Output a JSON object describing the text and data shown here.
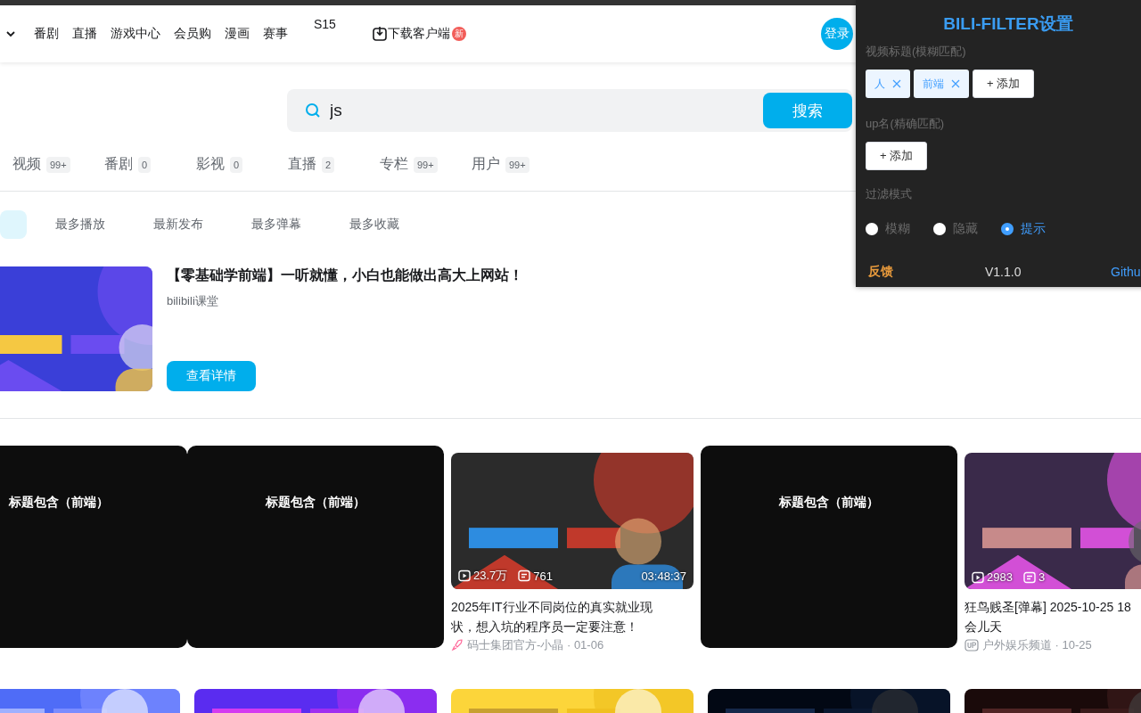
{
  "header": {
    "nav": [
      {
        "label": "番剧"
      },
      {
        "label": "直播"
      },
      {
        "label": "游戏中心"
      },
      {
        "label": "会员购"
      },
      {
        "label": "漫画"
      },
      {
        "label": "赛事"
      }
    ],
    "event": "S15",
    "download": {
      "label": "下载客户端",
      "badge": "新"
    },
    "login": "登录"
  },
  "search": {
    "value": "js",
    "button": "搜索"
  },
  "type_tabs": [
    {
      "label": "视频",
      "count": "99+"
    },
    {
      "label": "番剧",
      "count": "0"
    },
    {
      "label": "影视",
      "count": "0"
    },
    {
      "label": "直播",
      "count": "2"
    },
    {
      "label": "专栏",
      "count": "99+"
    },
    {
      "label": "用户",
      "count": "99+"
    }
  ],
  "sort_tabs": [
    {
      "selected": true
    },
    {
      "label": "最多播放",
      "selected": false
    },
    {
      "label": "最新发布",
      "selected": false
    },
    {
      "label": "最多弹幕",
      "selected": false
    },
    {
      "label": "最多收藏",
      "selected": false
    }
  ],
  "promo": {
    "title": "【零基础学前端】一听就懂，小白也能做出高大上网站！",
    "source": "bilibili课堂",
    "button": "查看详情"
  },
  "videos": [
    {
      "kind": "masked",
      "mask_label": "标题包含（前端）"
    },
    {
      "kind": "masked",
      "mask_label": "标题包含（前端）"
    },
    {
      "kind": "video",
      "views": "23.7万",
      "danmaku": "761",
      "duration": "03:48:37",
      "title_lines": [
        "2025年IT行业不同岗位的真实就业现",
        "状，想入坑的程序员一定要注意！"
      ],
      "author_icon": {
        "kind": "rocket"
      },
      "author": "码士集团官方-小晶 · 01-06"
    },
    {
      "kind": "masked",
      "mask_label": "标题包含（前端）"
    },
    {
      "kind": "video",
      "views": "2983",
      "danmaku": "3",
      "title_lines": [
        "狂鸟贱圣[弹幕] 2025-10-25 18",
        "会儿天"
      ],
      "author_icon": {
        "kind": "up"
      },
      "author": "户外娱乐频道 · 10-25"
    }
  ],
  "filter_panel": {
    "title": "BILI-FILTER设置",
    "title_section": {
      "label": "视频标题(模糊匹配)",
      "tags": [
        "人",
        "前端"
      ],
      "add": "+ 添加"
    },
    "up_section": {
      "label": "up名(精确匹配)",
      "add": "+ 添加"
    },
    "mode_label": "过滤模式",
    "modes": [
      {
        "label": "模糊",
        "selected": false
      },
      {
        "label": "隐藏",
        "selected": false
      },
      {
        "label": "提示",
        "selected": true
      }
    ],
    "feedback": "反馈",
    "version": "V1.1.0",
    "github": "Githu"
  }
}
